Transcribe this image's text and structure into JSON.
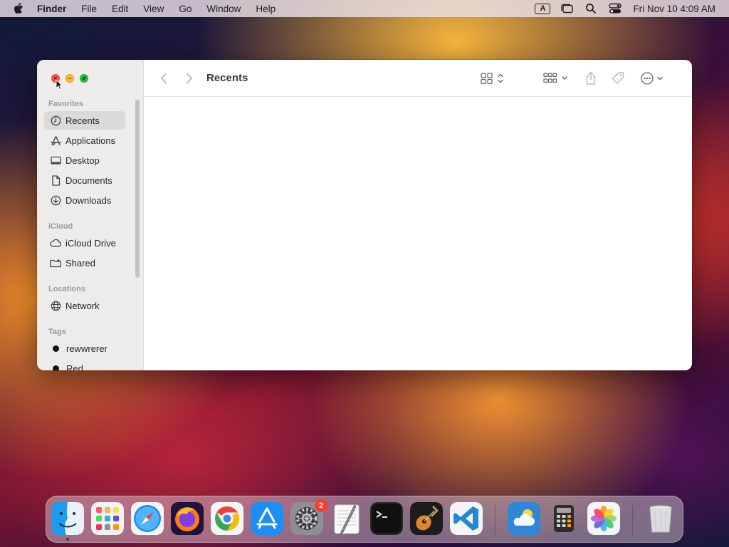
{
  "menubar": {
    "app_name": "Finder",
    "menus": [
      "File",
      "Edit",
      "View",
      "Go",
      "Window",
      "Help"
    ],
    "input_source": "A",
    "clock": "Fri Nov 10  4:09 AM"
  },
  "window": {
    "title": "Recents",
    "sidebar": {
      "favorites_title": "Favorites",
      "favorites": [
        {
          "label": "Recents",
          "icon": "clock-icon",
          "selected": true
        },
        {
          "label": "Applications",
          "icon": "applications-icon"
        },
        {
          "label": "Desktop",
          "icon": "desktop-icon"
        },
        {
          "label": "Documents",
          "icon": "document-icon"
        },
        {
          "label": "Downloads",
          "icon": "download-icon"
        }
      ],
      "icloud_title": "iCloud",
      "icloud": [
        {
          "label": "iCloud Drive",
          "icon": "cloud-icon"
        },
        {
          "label": "Shared",
          "icon": "shared-folder-icon"
        }
      ],
      "locations_title": "Locations",
      "locations": [
        {
          "label": "Network",
          "icon": "globe-icon"
        }
      ],
      "tags_title": "Tags",
      "tags": [
        {
          "label": "rewwrerer",
          "color": "#111111"
        },
        {
          "label": "Red",
          "color": "#111111"
        }
      ]
    },
    "toolbar": {
      "icons": [
        "back-icon",
        "forward-icon",
        "icon-view-icon",
        "group-icon",
        "share-icon",
        "tag-icon",
        "more-icon",
        "search-icon"
      ]
    }
  },
  "dock": {
    "apps": [
      "Finder",
      "Launchpad",
      "Safari",
      "Firefox",
      "Chrome",
      "App Store",
      "System Settings",
      "TextEdit",
      "Terminal",
      "GarageBand",
      "Visual Studio Code",
      "Weather",
      "Calculator",
      "Photos",
      "Trash"
    ],
    "settings_badge": "2"
  },
  "colors": {
    "close": "#ff5f57",
    "minimize": "#febc2e",
    "maximize": "#28c840",
    "badge": "#ff3b30"
  }
}
